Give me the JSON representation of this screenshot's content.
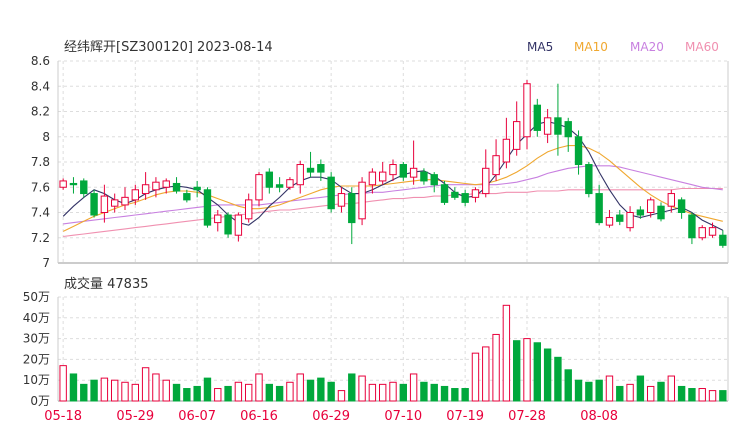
{
  "header": {
    "title": "经纬辉开[SZ300120] 2023-08-14",
    "ma_labels": [
      "MA5",
      "MA10",
      "MA20",
      "MA60"
    ]
  },
  "volume_panel": {
    "title": "成交量 47835"
  },
  "colors": {
    "up": "#e8003b",
    "down": "#00a83c",
    "ma5": "#333366",
    "ma10": "#f0a830",
    "ma20": "#c880e0",
    "ma60": "#f090b0",
    "grid": "#dddddd",
    "axis_label": "#e8003b"
  },
  "chart_data": [
    {
      "type": "candlestick",
      "title": "经纬辉开[SZ300120] 2023-08-14",
      "ylim": [
        7.0,
        8.6
      ],
      "y_ticks": [
        7,
        7.2,
        7.4,
        7.6,
        7.8,
        8,
        8.2,
        8.4,
        8.6
      ],
      "y_tick_labels": [
        "7",
        "7.2",
        "7.4",
        "7.6",
        "7.8",
        "8",
        "8.2",
        "8.4",
        "8.6"
      ],
      "x_tick_labels": [
        "05-18",
        "05-29",
        "06-07",
        "06-16",
        "06-29",
        "07-10",
        "07-19",
        "07-28",
        "08-08"
      ],
      "x_tick_index": [
        0,
        7,
        13,
        19,
        26,
        33,
        39,
        45,
        52
      ],
      "legend": [
        "MA5",
        "MA10",
        "MA20",
        "MA60"
      ],
      "legend_position": "top-right",
      "ohlc": [
        [
          7.6,
          7.65,
          7.58,
          7.67
        ],
        [
          7.63,
          7.62,
          7.55,
          7.68
        ],
        [
          7.65,
          7.55,
          7.52,
          7.67
        ],
        [
          7.55,
          7.38,
          7.36,
          7.58
        ],
        [
          7.4,
          7.53,
          7.32,
          7.62
        ],
        [
          7.45,
          7.5,
          7.4,
          7.55
        ],
        [
          7.46,
          7.52,
          7.42,
          7.6
        ],
        [
          7.5,
          7.58,
          7.46,
          7.62
        ],
        [
          7.55,
          7.62,
          7.5,
          7.72
        ],
        [
          7.58,
          7.64,
          7.52,
          7.68
        ],
        [
          7.6,
          7.65,
          7.55,
          7.67
        ],
        [
          7.63,
          7.57,
          7.55,
          7.68
        ],
        [
          7.55,
          7.5,
          7.48,
          7.58
        ],
        [
          7.6,
          7.58,
          7.52,
          7.65
        ],
        [
          7.58,
          7.3,
          7.28,
          7.6
        ],
        [
          7.32,
          7.38,
          7.25,
          7.42
        ],
        [
          7.38,
          7.23,
          7.2,
          7.4
        ],
        [
          7.22,
          7.38,
          7.17,
          7.4
        ],
        [
          7.35,
          7.5,
          7.32,
          7.55
        ],
        [
          7.5,
          7.7,
          7.45,
          7.72
        ],
        [
          7.72,
          7.6,
          7.55,
          7.75
        ],
        [
          7.62,
          7.6,
          7.56,
          7.68
        ],
        [
          7.6,
          7.66,
          7.58,
          7.68
        ],
        [
          7.62,
          7.78,
          7.55,
          7.81
        ],
        [
          7.75,
          7.72,
          7.68,
          7.88
        ],
        [
          7.78,
          7.72,
          7.65,
          7.82
        ],
        [
          7.68,
          7.43,
          7.4,
          7.72
        ],
        [
          7.45,
          7.55,
          7.4,
          7.6
        ],
        [
          7.55,
          7.32,
          7.15,
          7.6
        ],
        [
          7.35,
          7.64,
          7.3,
          7.68
        ],
        [
          7.62,
          7.72,
          7.55,
          7.75
        ],
        [
          7.65,
          7.72,
          7.62,
          7.8
        ],
        [
          7.7,
          7.78,
          7.65,
          7.82
        ],
        [
          7.78,
          7.68,
          7.65,
          7.8
        ],
        [
          7.68,
          7.75,
          7.62,
          7.97
        ],
        [
          7.72,
          7.65,
          7.62,
          7.75
        ],
        [
          7.7,
          7.62,
          7.56,
          7.72
        ],
        [
          7.62,
          7.48,
          7.46,
          7.65
        ],
        [
          7.56,
          7.52,
          7.5,
          7.6
        ],
        [
          7.55,
          7.48,
          7.45,
          7.58
        ],
        [
          7.52,
          7.58,
          7.48,
          7.6
        ],
        [
          7.55,
          7.75,
          7.52,
          7.9
        ],
        [
          7.7,
          7.85,
          7.65,
          7.98
        ],
        [
          7.8,
          7.98,
          7.75,
          8.15
        ],
        [
          7.9,
          8.12,
          7.85,
          8.28
        ],
        [
          8.0,
          8.42,
          7.9,
          8.45
        ],
        [
          8.25,
          8.05,
          8.0,
          8.3
        ],
        [
          8.02,
          8.15,
          7.95,
          8.22
        ],
        [
          8.15,
          8.02,
          7.85,
          8.42
        ],
        [
          8.12,
          8.0,
          7.88,
          8.15
        ],
        [
          8.0,
          7.78,
          7.7,
          8.05
        ],
        [
          7.78,
          7.55,
          7.52,
          7.8
        ],
        [
          7.55,
          7.32,
          7.3,
          7.62
        ],
        [
          7.3,
          7.36,
          7.28,
          7.42
        ],
        [
          7.38,
          7.33,
          7.3,
          7.42
        ],
        [
          7.28,
          7.4,
          7.25,
          7.45
        ],
        [
          7.42,
          7.38,
          7.35,
          7.45
        ],
        [
          7.4,
          7.5,
          7.36,
          7.52
        ],
        [
          7.45,
          7.35,
          7.33,
          7.48
        ],
        [
          7.45,
          7.55,
          7.4,
          7.58
        ],
        [
          7.5,
          7.4,
          7.35,
          7.52
        ],
        [
          7.38,
          7.2,
          7.15,
          7.4
        ],
        [
          7.2,
          7.28,
          7.18,
          7.3
        ],
        [
          7.22,
          7.28,
          7.2,
          7.32
        ],
        [
          7.22,
          7.14,
          7.12,
          7.26
        ]
      ],
      "ma5": [
        7.37,
        7.45,
        7.52,
        7.58,
        7.55,
        7.5,
        7.47,
        7.5,
        7.55,
        7.58,
        7.6,
        7.61,
        7.6,
        7.58,
        7.52,
        7.46,
        7.38,
        7.32,
        7.3,
        7.36,
        7.45,
        7.52,
        7.6,
        7.65,
        7.68,
        7.68,
        7.66,
        7.6,
        7.55,
        7.55,
        7.58,
        7.62,
        7.66,
        7.7,
        7.72,
        7.73,
        7.69,
        7.63,
        7.56,
        7.52,
        7.53,
        7.6,
        7.7,
        7.82,
        7.94,
        8.02,
        8.1,
        8.12,
        8.1,
        8.07,
        8.0,
        7.88,
        7.72,
        7.58,
        7.46,
        7.38,
        7.36,
        7.38,
        7.4,
        7.42,
        7.44,
        7.4,
        7.34,
        7.3,
        7.26
      ],
      "ma10": [
        7.25,
        7.29,
        7.33,
        7.37,
        7.4,
        7.43,
        7.46,
        7.48,
        7.51,
        7.54,
        7.56,
        7.57,
        7.57,
        7.56,
        7.54,
        7.51,
        7.48,
        7.45,
        7.43,
        7.43,
        7.44,
        7.46,
        7.49,
        7.52,
        7.55,
        7.58,
        7.6,
        7.61,
        7.61,
        7.61,
        7.61,
        7.62,
        7.63,
        7.64,
        7.65,
        7.66,
        7.66,
        7.65,
        7.64,
        7.63,
        7.62,
        7.63,
        7.65,
        7.68,
        7.72,
        7.77,
        7.83,
        7.88,
        7.91,
        7.93,
        7.93,
        7.91,
        7.87,
        7.81,
        7.74,
        7.67,
        7.6,
        7.54,
        7.49,
        7.45,
        7.42,
        7.39,
        7.37,
        7.35,
        7.33
      ],
      "ma20": [
        7.31,
        7.32,
        7.33,
        7.34,
        7.35,
        7.36,
        7.37,
        7.38,
        7.39,
        7.4,
        7.41,
        7.42,
        7.43,
        7.44,
        7.45,
        7.46,
        7.46,
        7.46,
        7.46,
        7.46,
        7.47,
        7.48,
        7.49,
        7.5,
        7.51,
        7.52,
        7.53,
        7.54,
        7.55,
        7.55,
        7.56,
        7.56,
        7.57,
        7.58,
        7.59,
        7.6,
        7.61,
        7.62,
        7.62,
        7.62,
        7.62,
        7.62,
        7.62,
        7.63,
        7.64,
        7.66,
        7.68,
        7.71,
        7.73,
        7.75,
        7.76,
        7.77,
        7.77,
        7.77,
        7.76,
        7.74,
        7.72,
        7.7,
        7.68,
        7.66,
        7.64,
        7.62,
        7.6,
        7.59,
        7.58
      ],
      "ma60": [
        7.21,
        7.22,
        7.23,
        7.24,
        7.25,
        7.26,
        7.27,
        7.28,
        7.29,
        7.3,
        7.31,
        7.32,
        7.33,
        7.34,
        7.35,
        7.36,
        7.37,
        7.38,
        7.39,
        7.4,
        7.41,
        7.42,
        7.42,
        7.43,
        7.44,
        7.45,
        7.46,
        7.47,
        7.47,
        7.48,
        7.49,
        7.5,
        7.51,
        7.51,
        7.52,
        7.52,
        7.53,
        7.53,
        7.54,
        7.54,
        7.55,
        7.55,
        7.55,
        7.56,
        7.56,
        7.56,
        7.57,
        7.57,
        7.57,
        7.58,
        7.58,
        7.58,
        7.58,
        7.58,
        7.58,
        7.58,
        7.58,
        7.58,
        7.58,
        7.58,
        7.59,
        7.59,
        7.59,
        7.59,
        7.59
      ]
    },
    {
      "type": "bar",
      "title": "成交量 47835",
      "ylim": [
        0,
        50
      ],
      "y_ticks": [
        0,
        10,
        20,
        30,
        40,
        50
      ],
      "y_tick_labels": [
        "0万",
        "10万",
        "20万",
        "30万",
        "40万",
        "50万"
      ],
      "values": [
        17,
        13,
        8,
        10,
        11,
        10,
        9,
        8,
        16,
        13,
        10,
        8,
        6,
        7,
        11,
        6,
        7,
        9,
        8,
        13,
        8,
        7,
        9,
        13,
        10,
        11,
        9,
        5,
        13,
        12,
        8,
        8,
        9,
        8,
        13,
        9,
        8,
        7,
        6,
        6,
        23,
        26,
        32,
        46,
        29,
        30,
        28,
        25,
        21,
        15,
        10,
        9,
        10,
        12,
        7,
        8,
        12,
        7,
        9,
        12,
        7,
        6,
        6,
        5,
        5
      ],
      "up": [
        true,
        false,
        false,
        false,
        true,
        true,
        true,
        true,
        true,
        true,
        true,
        false,
        false,
        false,
        false,
        true,
        false,
        true,
        true,
        true,
        false,
        false,
        true,
        true,
        false,
        false,
        false,
        true,
        false,
        true,
        true,
        true,
        true,
        false,
        true,
        false,
        false,
        false,
        false,
        false,
        true,
        true,
        true,
        true,
        false,
        true,
        false,
        false,
        false,
        false,
        false,
        false,
        false,
        true,
        false,
        true,
        false,
        true,
        false,
        true,
        false,
        false,
        true,
        true,
        false
      ]
    }
  ]
}
